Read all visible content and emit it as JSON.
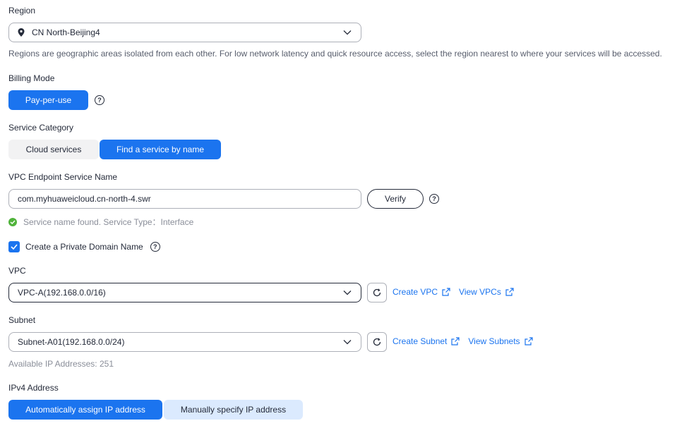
{
  "region": {
    "label": "Region",
    "value": "CN North-Beijing4",
    "hint": "Regions are geographic areas isolated from each other. For low network latency and quick resource access, select the region nearest to where your services will be accessed."
  },
  "billing": {
    "label": "Billing Mode",
    "option": "Pay-per-use"
  },
  "service_category": {
    "label": "Service Category",
    "options": [
      "Cloud services",
      "Find a service by name"
    ],
    "selected": "Find a service by name"
  },
  "endpoint_service": {
    "label": "VPC Endpoint Service Name",
    "value": "com.myhuaweicloud.cn-north-4.swr",
    "verify_label": "Verify",
    "status": "Service name found. Service Type：Interface"
  },
  "private_domain": {
    "label": "Create a Private Domain Name",
    "checked": true
  },
  "vpc": {
    "label": "VPC",
    "value": "VPC-A(192.168.0.0/16)",
    "create_link": "Create VPC",
    "view_link": "View VPCs"
  },
  "subnet": {
    "label": "Subnet",
    "value": "Subnet-A01(192.168.0.0/24)",
    "create_link": "Create Subnet",
    "view_link": "View Subnets",
    "available": "Available IP Addresses: 251"
  },
  "ipv4": {
    "label": "IPv4 Address",
    "options": [
      "Automatically assign IP address",
      "Manually specify IP address"
    ],
    "selected": "Automatically assign IP address"
  },
  "colors": {
    "primary": "#1b74ef",
    "success": "#50b33b",
    "text": "#252b3a",
    "muted": "#575d6c"
  }
}
